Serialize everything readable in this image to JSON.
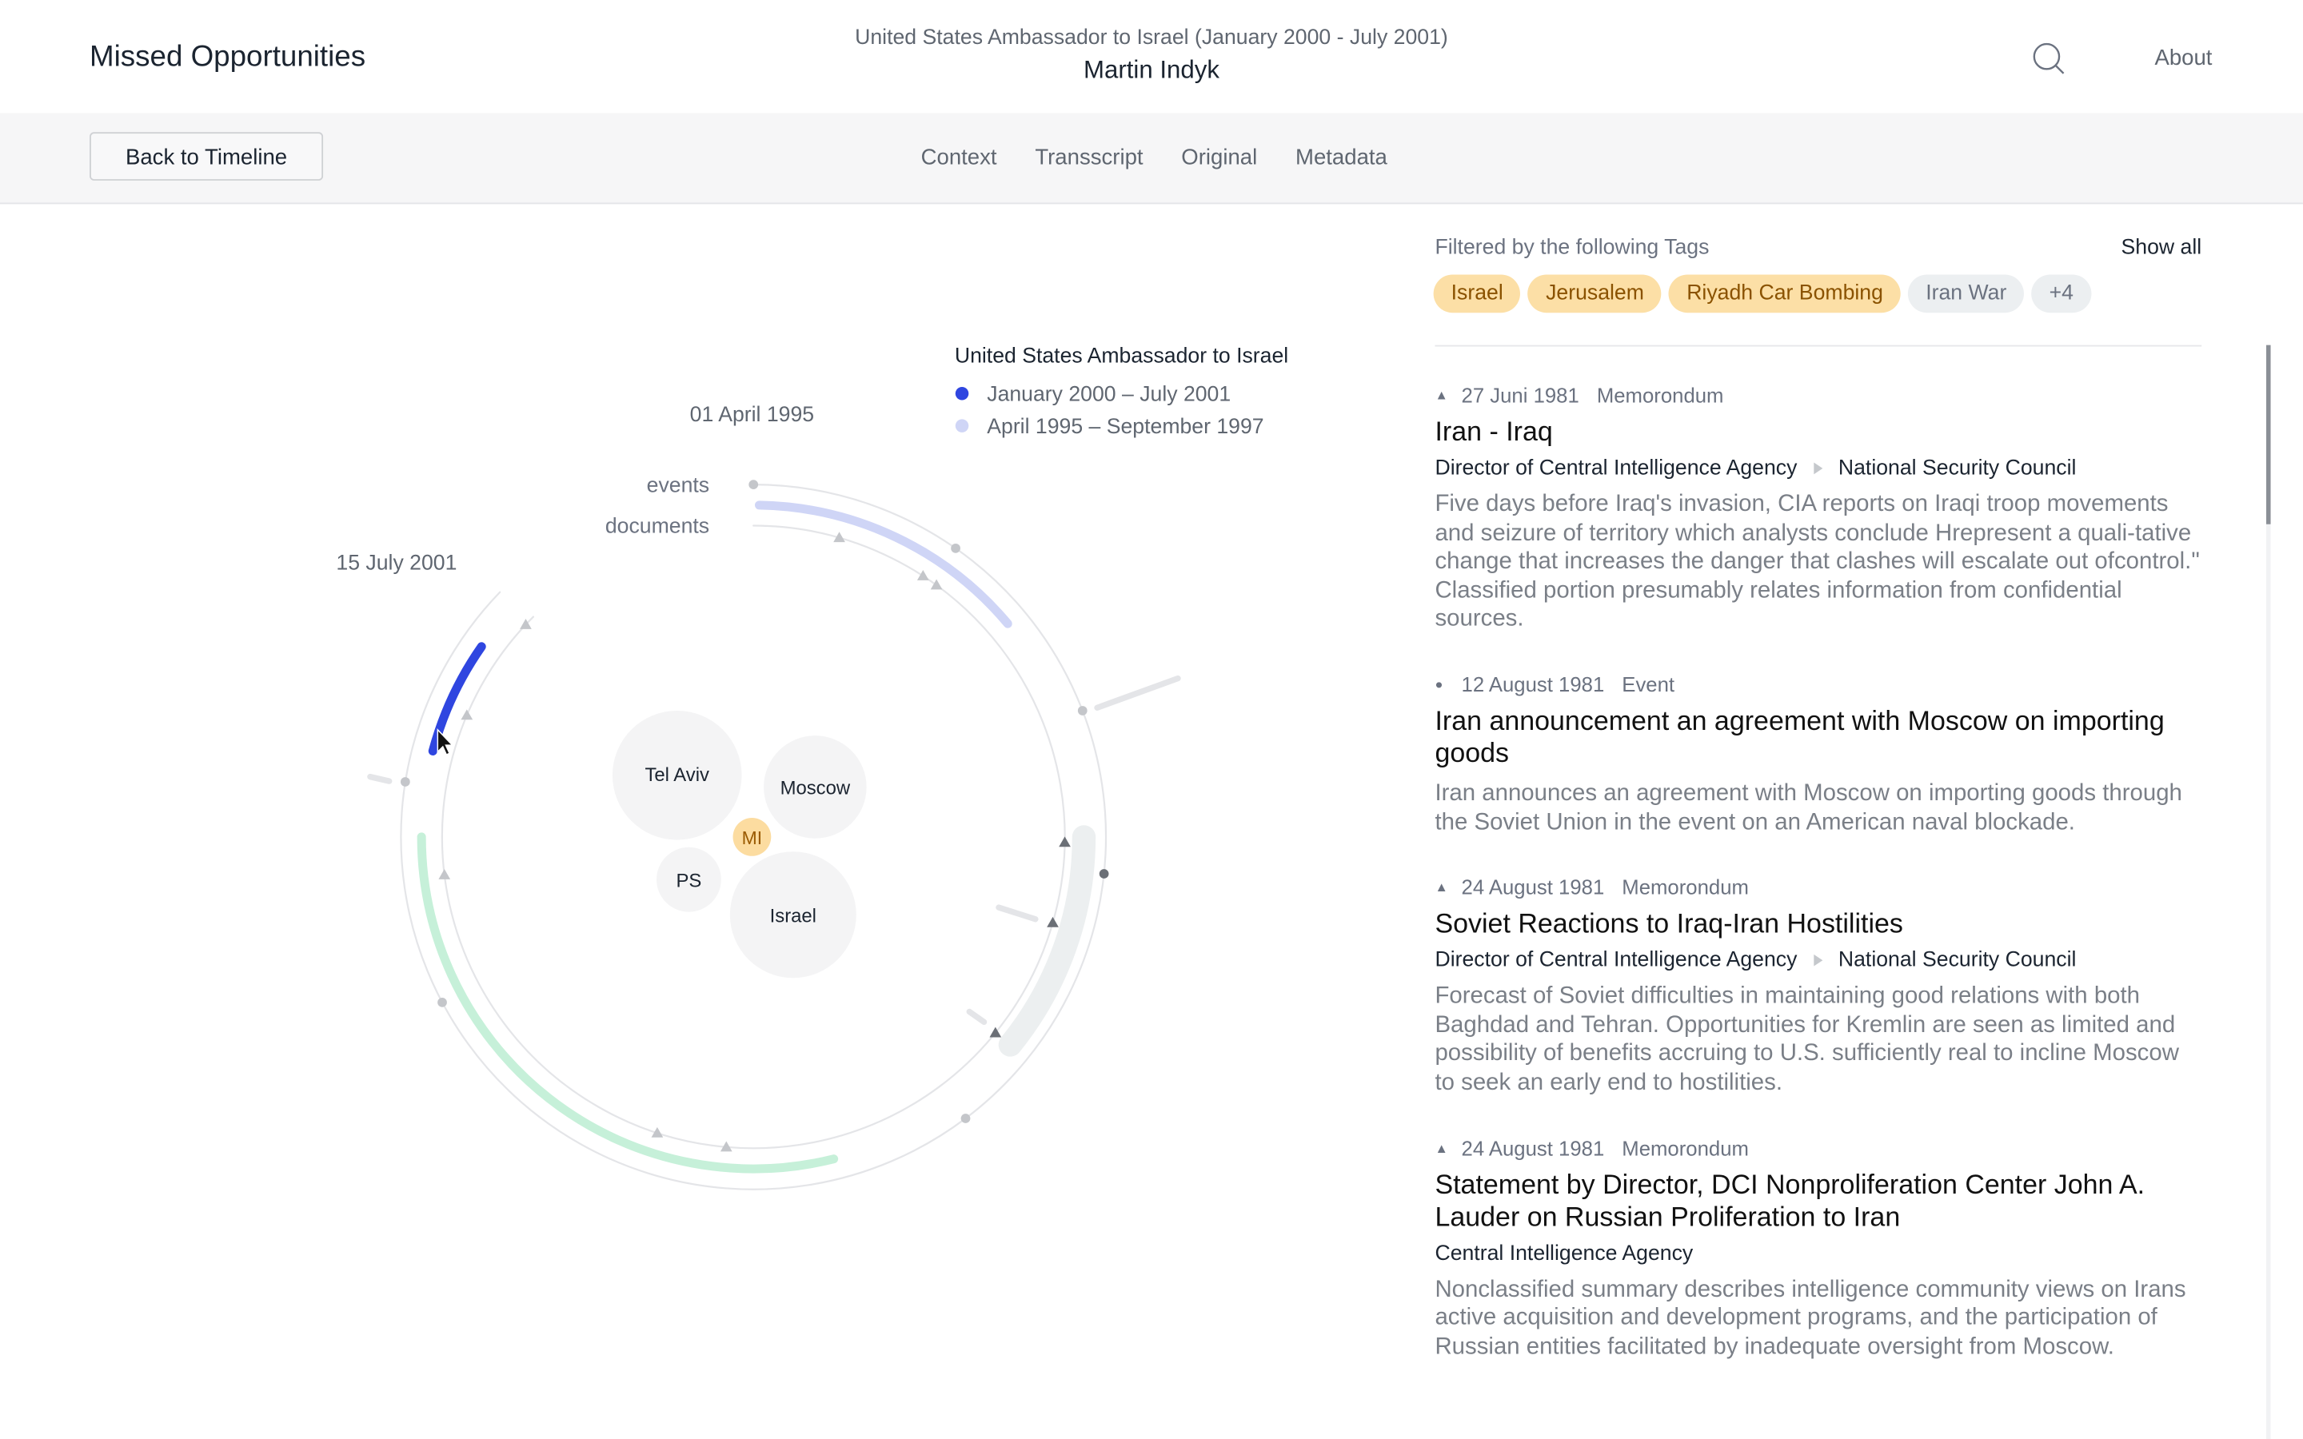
{
  "header": {
    "brand": "Missed Opportunities",
    "subtitle": "United States Ambassador to Israel (January 2000 - July 2001)",
    "name": "Martin Indyk",
    "search_icon": "search-icon",
    "about": "About"
  },
  "subbar": {
    "back": "Back to Timeline",
    "tabs": [
      "Context",
      "Transscript",
      "Original",
      "Metadata"
    ]
  },
  "viz": {
    "legend_title": "United States Ambassador to Israel",
    "legend": [
      {
        "label": "January 2000 – July 2001",
        "color": "#2f46e0"
      },
      {
        "label": "April 1995 – September 1997",
        "color": "#cfd5f6"
      }
    ],
    "date_start": "01 April 1995",
    "date_end": "15 July 2001",
    "ring_events": "events",
    "ring_documents": "documents",
    "bubbles": [
      {
        "label": "Tel Aviv"
      },
      {
        "label": "Moscow"
      },
      {
        "label": "MI",
        "highlight": true
      },
      {
        "label": "PS"
      },
      {
        "label": "Israel"
      }
    ],
    "colors": {
      "term_current": "#2f46e0",
      "term_previous": "#cfd5f6",
      "other_term": "#c6f0d9",
      "selected_range": "#eceff0",
      "highlight_bubble": "#fcdca0"
    }
  },
  "filters": {
    "title": "Filtered by the following Tags",
    "show_all": "Show all",
    "tags": [
      {
        "label": "Israel",
        "active": true
      },
      {
        "label": "Jerusalem",
        "active": true
      },
      {
        "label": "Riyadh Car Bombing",
        "active": true
      },
      {
        "label": "Iran War",
        "active": false
      },
      {
        "label": "+4",
        "active": false
      }
    ]
  },
  "items": [
    {
      "icon": "triangle",
      "date": "27 Juni 1981",
      "type": "Memorondum",
      "title": "Iran - Iraq",
      "from": "Director of Central Intelligence Agency",
      "to": "National Security Council",
      "desc": "Five days before Iraq's invasion, CIA reports on Iraqi troop movements and seizure of territory which analysts conclude Hrepresent a quali-tative change that increases the danger that clashes will escalate out ofcontrol.\" Classified portion presumably relates information from confidential sources."
    },
    {
      "icon": "dot",
      "date": "12 August 1981",
      "type": "Event",
      "title": "Iran announcement an agreement with Moscow on importing goods",
      "desc": "Iran announces an agreement with Moscow on importing goods through the Soviet Union in the event on an American naval blockade."
    },
    {
      "icon": "triangle",
      "date": "24 August 1981",
      "type": "Memorondum",
      "title": "Soviet Reactions to Iraq-Iran Hostilities",
      "from": "Director of Central Intelligence Agency",
      "to": "National Security Council",
      "desc": "Forecast of Soviet difficulties in maintaining good relations with both Baghdad and Tehran. Opportunities for Kremlin are seen as limited and possibility of benefits accruing to U.S. sufficiently real to incline Moscow to seek an early end to hostilities."
    },
    {
      "icon": "triangle",
      "date": "24 August 1981",
      "type": "Memorondum",
      "title": "Statement by Director, DCI Nonproliferation Center John A. Lauder on Russian Proliferation to Iran",
      "from": "Central Intelligence Agency",
      "desc": "Nonclassified summary describes intelligence community views on Irans active acquisition and development programs, and the participation of Russian entities facilitated by inadequate oversight from Moscow."
    }
  ]
}
